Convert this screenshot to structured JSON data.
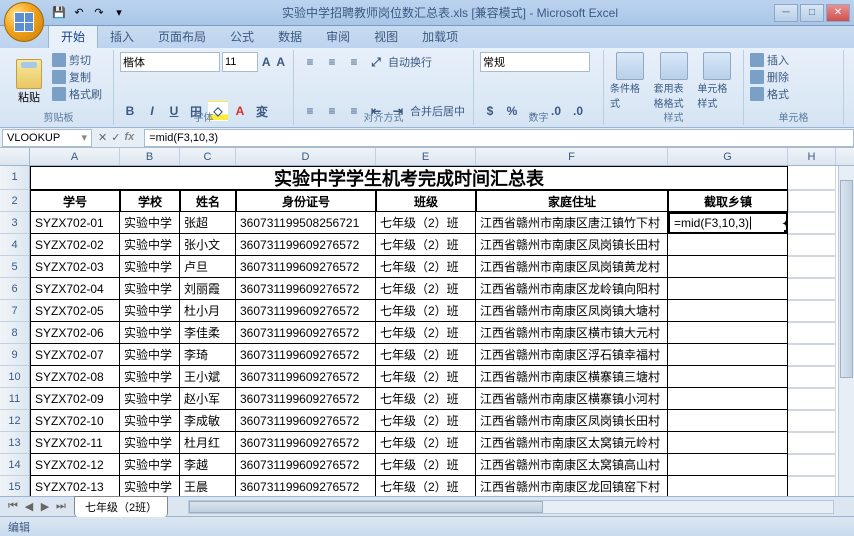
{
  "app": {
    "title": "实验中学招聘教师岗位数汇总表.xls [兼容模式] - Microsoft Excel"
  },
  "ribbon": {
    "tabs": [
      "开始",
      "插入",
      "页面布局",
      "公式",
      "数据",
      "审阅",
      "视图",
      "加载项"
    ],
    "active_tab": "开始",
    "groups": {
      "clipboard": {
        "label": "剪贴板",
        "paste": "粘贴",
        "cut": "剪切",
        "copy": "复制",
        "format": "格式刷"
      },
      "font": {
        "label": "字体",
        "name": "楷体",
        "size": "11"
      },
      "align": {
        "label": "对齐方式",
        "wrap": "自动换行",
        "merge": "合并后居中"
      },
      "number": {
        "label": "数字",
        "format": "常规"
      },
      "styles": {
        "label": "样式",
        "cond": "条件格式",
        "table": "套用表格格式",
        "cell": "单元格样式"
      },
      "cells": {
        "label": "单元格",
        "insert": "插入",
        "delete": "删除",
        "format": "格式"
      }
    }
  },
  "namebox": "VLOOKUP",
  "formula": "=mid(F3,10,3)",
  "columns": [
    "A",
    "B",
    "C",
    "D",
    "E",
    "F",
    "G",
    "H"
  ],
  "title_row": "实验中学学生机考完成时间汇总表",
  "headers": [
    "学号",
    "学校",
    "姓名",
    "身份证号",
    "班级",
    "家庭住址",
    "截取乡镇"
  ],
  "rows": [
    {
      "n": 3,
      "a": "SYZX702-01",
      "b": "实验中学",
      "c": "张超",
      "d": "360731199508256721",
      "e": "七年级（2）班",
      "f": "江西省赣州市南康区唐江镇竹下村",
      "g": "=mid(F3,10,3)"
    },
    {
      "n": 4,
      "a": "SYZX702-02",
      "b": "实验中学",
      "c": "张小文",
      "d": "360731199609276572",
      "e": "七年级（2）班",
      "f": "江西省赣州市南康区凤岗镇长田村",
      "g": ""
    },
    {
      "n": 5,
      "a": "SYZX702-03",
      "b": "实验中学",
      "c": "卢旦",
      "d": "360731199609276572",
      "e": "七年级（2）班",
      "f": "江西省赣州市南康区凤岗镇黄龙村",
      "g": ""
    },
    {
      "n": 6,
      "a": "SYZX702-04",
      "b": "实验中学",
      "c": "刘丽霞",
      "d": "360731199609276572",
      "e": "七年级（2）班",
      "f": "江西省赣州市南康区龙岭镇向阳村",
      "g": ""
    },
    {
      "n": 7,
      "a": "SYZX702-05",
      "b": "实验中学",
      "c": "杜小月",
      "d": "360731199609276572",
      "e": "七年级（2）班",
      "f": "江西省赣州市南康区凤岗镇大塘村",
      "g": ""
    },
    {
      "n": 8,
      "a": "SYZX702-06",
      "b": "实验中学",
      "c": "李佳柔",
      "d": "360731199609276572",
      "e": "七年级（2）班",
      "f": "江西省赣州市南康区横市镇大元村",
      "g": ""
    },
    {
      "n": 9,
      "a": "SYZX702-07",
      "b": "实验中学",
      "c": "李琦",
      "d": "360731199609276572",
      "e": "七年级（2）班",
      "f": "江西省赣州市南康区浮石镇幸福村",
      "g": ""
    },
    {
      "n": 10,
      "a": "SYZX702-08",
      "b": "实验中学",
      "c": "王小斌",
      "d": "360731199609276572",
      "e": "七年级（2）班",
      "f": "江西省赣州市南康区横寨镇三塘村",
      "g": ""
    },
    {
      "n": 11,
      "a": "SYZX702-09",
      "b": "实验中学",
      "c": "赵小军",
      "d": "360731199609276572",
      "e": "七年级（2）班",
      "f": "江西省赣州市南康区横寨镇小河村",
      "g": ""
    },
    {
      "n": 12,
      "a": "SYZX702-10",
      "b": "实验中学",
      "c": "李成敏",
      "d": "360731199609276572",
      "e": "七年级（2）班",
      "f": "江西省赣州市南康区凤岗镇长田村",
      "g": ""
    },
    {
      "n": 13,
      "a": "SYZX702-11",
      "b": "实验中学",
      "c": "杜月红",
      "d": "360731199609276572",
      "e": "七年级（2）班",
      "f": "江西省赣州市南康区太窝镇元岭村",
      "g": ""
    },
    {
      "n": 14,
      "a": "SYZX702-12",
      "b": "实验中学",
      "c": "李越",
      "d": "360731199609276572",
      "e": "七年级（2）班",
      "f": "江西省赣州市南康区太窝镇高山村",
      "g": ""
    },
    {
      "n": 15,
      "a": "SYZX702-13",
      "b": "实验中学",
      "c": "王晨",
      "d": "360731199609276572",
      "e": "七年级（2）班",
      "f": "江西省赣州市南康区龙回镇窑下村",
      "g": ""
    }
  ],
  "sheet_tab": "七年级（2班）",
  "status": "编辑"
}
